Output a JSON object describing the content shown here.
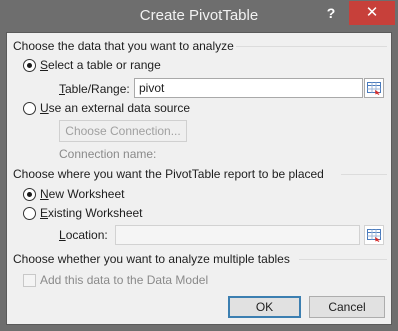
{
  "window": {
    "title": "Create PivotTable",
    "help_label": "?",
    "close_label": "✕"
  },
  "source_group": {
    "heading": "Choose the data that you want to analyze",
    "select_range": {
      "prefix": "",
      "underline": "S",
      "rest": "elect a table or range",
      "checked": true
    },
    "table_range": {
      "underline": "T",
      "rest": "able/Range:",
      "value": "pivot"
    },
    "external": {
      "underline": "U",
      "rest": "se an external data source",
      "checked": false
    },
    "choose_connection_label": "Choose Connection...",
    "connection_name_label": "Connection name:"
  },
  "placement_group": {
    "heading": "Choose where you want the PivotTable report to be placed",
    "new_worksheet": {
      "underline": "N",
      "rest": "ew Worksheet",
      "checked": true
    },
    "existing_worksheet": {
      "underline": "E",
      "rest": "xisting Worksheet",
      "checked": false
    },
    "location": {
      "underline": "L",
      "rest": "ocation:",
      "value": ""
    }
  },
  "multi_group": {
    "heading": "Choose whether you want to analyze multiple tables",
    "data_model": {
      "label": "Add this data to the Data Model",
      "checked": false,
      "enabled": false
    }
  },
  "buttons": {
    "ok_label": "OK",
    "cancel_label": "Cancel"
  },
  "colors": {
    "titlebar": "#6e6e6e",
    "close": "#c7403a",
    "client": "#f0f0f0",
    "accent": "#3c7fb1"
  }
}
